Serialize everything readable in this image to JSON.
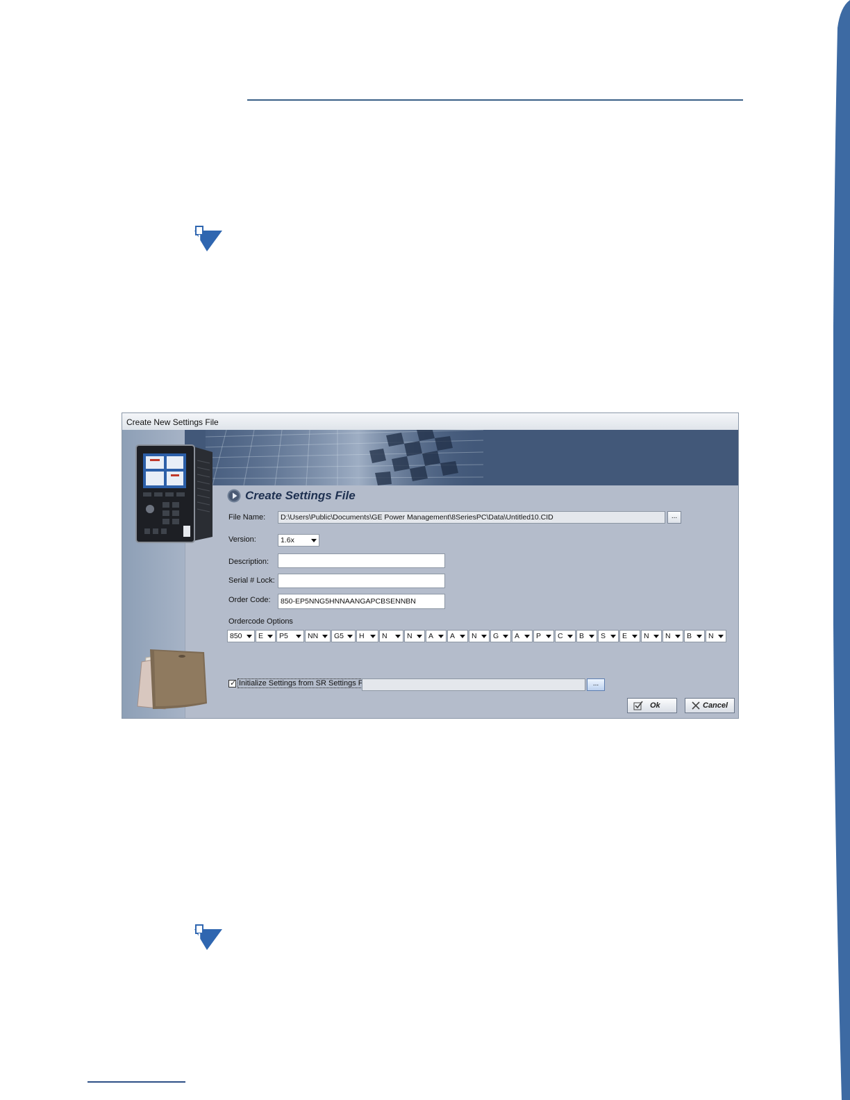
{
  "dialog": {
    "title": "Create New Settings File",
    "heading": "Create Settings File",
    "file_name": {
      "label": "File Name:",
      "value": "D:\\Users\\Public\\Documents\\GE Power Management\\8SeriesPC\\Data\\Untitled10.CID",
      "browse_label": "..."
    },
    "version": {
      "label": "Version:",
      "value": "1.6x"
    },
    "description": {
      "label": "Description:",
      "value": ""
    },
    "serial_lock": {
      "label": "Serial # Lock:",
      "value": ""
    },
    "order_code": {
      "label": "Order Code:",
      "value": "850-EP5NNG5HNNAANGAPCBSENNBN"
    },
    "ordercode_options": {
      "label": "Ordercode Options",
      "values": [
        "850",
        "E",
        "P5",
        "NN",
        "G5",
        "H",
        "N",
        "N",
        "A",
        "A",
        "N",
        "G",
        "A",
        "P",
        "C",
        "B",
        "S",
        "E",
        "N",
        "N",
        "B",
        "N"
      ]
    },
    "init_from_sr": {
      "label": "Initialize Settings from SR Settings File",
      "checked": true,
      "path": "",
      "browse_label": "..."
    },
    "ok_label": "Ok",
    "cancel_label": "Cancel"
  },
  "colors": {
    "accent_rule": "#3a5f86",
    "banner": "#425879",
    "dialog_body": "#b4bccb"
  }
}
